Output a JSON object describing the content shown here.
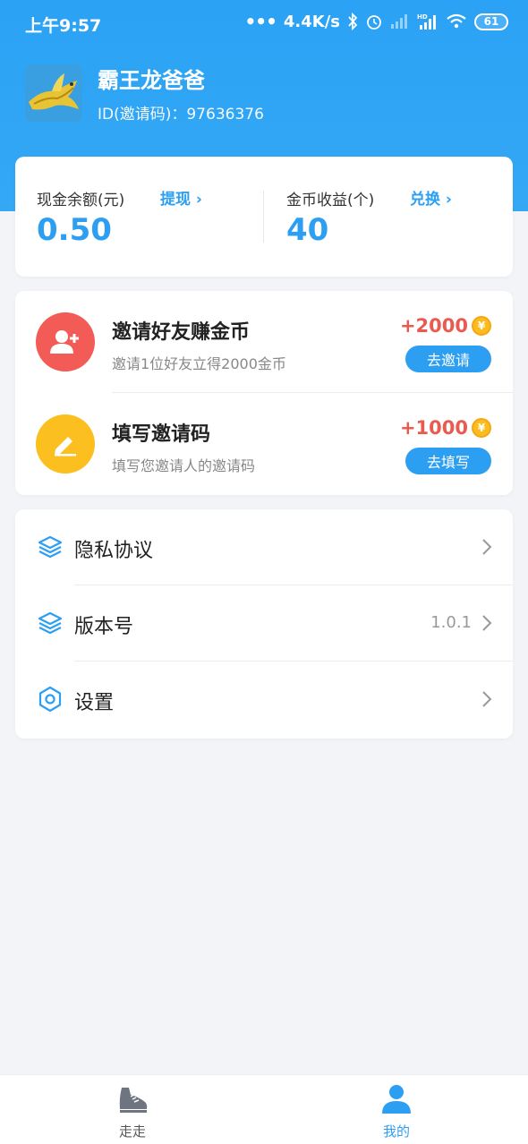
{
  "status_bar": {
    "time": "上午9:57",
    "speed": "4.4K/s",
    "battery": "61"
  },
  "profile": {
    "name": "霸王龙爸爸",
    "id_text": "ID(邀请码)：97636376"
  },
  "balance": {
    "cash_label": "现金余额(元)",
    "cash_link": "提现 ›",
    "cash_value": "0.50",
    "coin_label": "金币收益(个)",
    "coin_link": "兑换 ›",
    "coin_value": "40"
  },
  "tasks": [
    {
      "title": "邀请好友赚金币",
      "desc": "邀请1位好友立得2000金币",
      "reward": "+2000",
      "button": "去邀请",
      "icon": "add-user-icon"
    },
    {
      "title": "填写邀请码",
      "desc": "填写您邀请人的邀请码",
      "reward": "+1000",
      "button": "去填写",
      "icon": "pencil-icon"
    }
  ],
  "coin_symbol": "¥",
  "menu": [
    {
      "label": "隐私协议",
      "value": "",
      "icon": "layers-icon"
    },
    {
      "label": "版本号",
      "value": "1.0.1",
      "icon": "layers-icon"
    },
    {
      "label": "设置",
      "value": "",
      "icon": "hexagon-settings-icon"
    }
  ],
  "tabbar": {
    "tab1_label": "走走",
    "tab2_label": "我的",
    "active_color": "#2d9ff2"
  },
  "colors": {
    "primary": "#2d9ff2",
    "reward": "#ea5a4f",
    "invite_icon_bg": "#f35b57",
    "fill_icon_bg": "#fbbf1f"
  }
}
